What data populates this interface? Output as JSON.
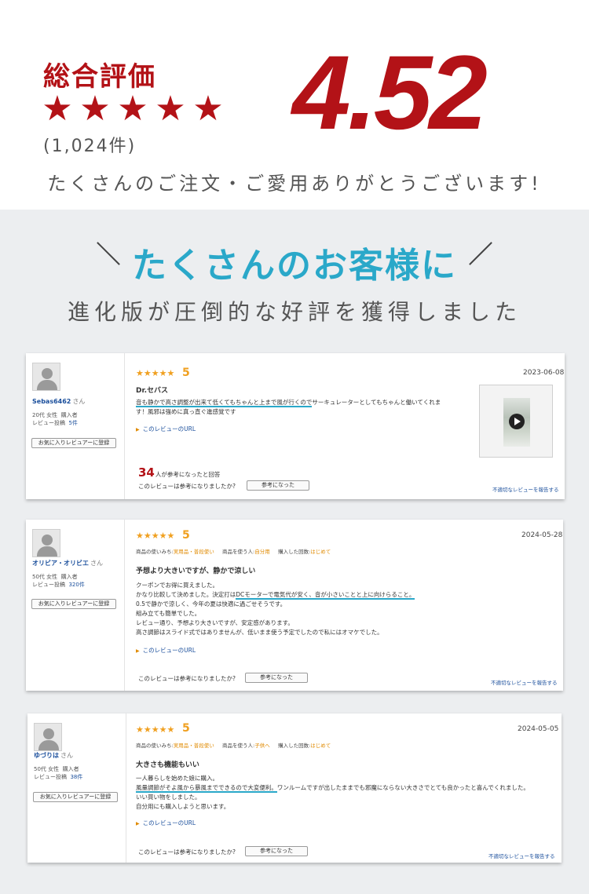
{
  "summary": {
    "label": "総合評価",
    "stars": [
      "★",
      "★",
      "★",
      "★",
      "★"
    ],
    "count": "(1,024件)",
    "score": "4.52",
    "thanks": "たくさんのご注文・ご愛用ありがとうございます!"
  },
  "banner": {
    "headline": "たくさんのお客様に",
    "subline": "進化版が圧倒的な好評を獲得しました"
  },
  "colors": {
    "accent_red": "#b31217",
    "accent_cyan": "#2aa8c9",
    "star_orange": "#f0a020",
    "link_blue": "#1b4f9c"
  },
  "reviews": [
    {
      "user": "Sebas6462",
      "san": "さん",
      "age_gender": "20代 女性",
      "buyer": "購入者",
      "posts_label": "レビュー投稿",
      "posts": "5件",
      "fav_button": "お気に入りレビュアーに登録",
      "stars": "★★★★★",
      "score": "5",
      "date": "2023-06-08",
      "title": "Dr.セバス",
      "body_line1_ul": "音も静かで高さ調整が出来て低くてもちゃんと上まで風が行くので",
      "body_line1_rest": "サーキュレーターとしてもちゃんと働いてくれま",
      "body_line2": "す！風邪は強めに真っ直ぐ進感覚です",
      "url_text": "このレビューのURL",
      "helpful_num": "34",
      "helpful_suffix": "人が参考になったと回答",
      "helpful_question": "このレビューは参考になりましたか?",
      "helpful_button": "参考になった",
      "report": "不適切なレビューを報告する",
      "thumb_icon": "play-icon"
    },
    {
      "user": "オリビア・オリビエ",
      "san": "さん",
      "age_gender": "50代 女性",
      "buyer": "購入者",
      "posts_label": "レビュー投稿",
      "posts": "320件",
      "fav_button": "お気に入りレビュアーに登録",
      "stars": "★★★★★",
      "score": "5",
      "date": "2024-05-28",
      "meta_use_label": "商品の使いみち:",
      "meta_use": "実用品・普段使い",
      "meta_who_label": "商品を使う人:",
      "meta_who": "自分用",
      "meta_times_label": "購入した回数:",
      "meta_times": "はじめて",
      "title": "予想より大きいですが、静かで涼しい",
      "body": [
        "クーポンでお得に買えました。",
        "かなり比較して決めました。決定打は",
        "0.5で静かで涼しく、今年の夏は快適に過ごせそうです。",
        "組み立ても簡単でした。",
        "レビュー通り、予想より大きいですが、安定感があります。",
        "高さ調節はスライド式ではありませんが、低いまま使う予定でしたので私にはオマケでした。"
      ],
      "body_line2_ul": "DCモーターで電気代が安く、音が小さいことと上に向けらること。",
      "url_text": "このレビューのURL",
      "helpful_question": "このレビューは参考になりましたか?",
      "helpful_button": "参考になった",
      "report": "不適切なレビューを報告する"
    },
    {
      "user": "ゆづりは",
      "san": "さん",
      "age_gender": "50代 女性",
      "buyer": "購入者",
      "posts_label": "レビュー投稿",
      "posts": "38件",
      "fav_button": "お気に入りレビュアーに登録",
      "stars": "★★★★★",
      "score": "5",
      "date": "2024-05-05",
      "meta_use_label": "商品の使いみち:",
      "meta_use": "実用品・普段使い",
      "meta_who_label": "商品を使う人:",
      "meta_who": "子供へ",
      "meta_times_label": "購入した回数:",
      "meta_times": "はじめて",
      "title": "大きさも機能もいい",
      "body_line1": "一人暮らしを始めた娘に購入。",
      "body_line2_ul": "風量調節がそよ風から暴風までできるので大変便利。",
      "body_line2_rest": "ワンルームですが出したままでも邪魔にならない大きさでとても良かったと喜んでくれました。",
      "body_line3": "いい買い物をしました。",
      "body_line4": "自分用にも購入しようと思います。",
      "url_text": "このレビューのURL",
      "helpful_question": "このレビューは参考になりましたか?",
      "helpful_button": "参考になった",
      "report": "不適切なレビューを報告する"
    }
  ]
}
